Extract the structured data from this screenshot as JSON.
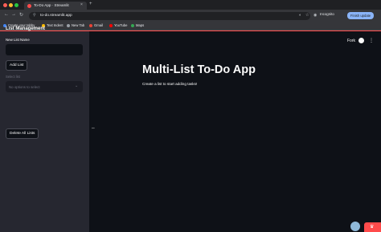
{
  "browser": {
    "tab_title": "To-Do App · Streamlit",
    "tab_close": "×",
    "new_tab": "+",
    "back": "←",
    "forward": "→",
    "reload": "↻",
    "url": "to-do.streamlit.app",
    "incognito_label": "Incognito",
    "finish_update_label": "Finish update",
    "bookmarks": [
      {
        "label": "Create your tabby",
        "color": "#4285f4"
      },
      {
        "label": "Text Indent",
        "color": "#fbbc04"
      },
      {
        "label": "New Tab",
        "color": "#9aa0a6"
      },
      {
        "label": "Gmail",
        "color": "#ea4335"
      },
      {
        "label": "YouTube",
        "color": "#ff0000"
      },
      {
        "label": "Maps",
        "color": "#34a853"
      }
    ]
  },
  "sidebar": {
    "title": "List Management",
    "new_list_label": "New List Name",
    "new_list_value": "",
    "add_list_button": "Add List",
    "select_label": "Select list",
    "select_placeholder": "No options to select",
    "select_chevron": "⌄",
    "delete_all_button": "Delete All Lists"
  },
  "header": {
    "deploy_label": "Fork",
    "menu_glyph": "⋮"
  },
  "main": {
    "title": "Multi-List To-Do App",
    "caption": "Create a list to start adding tasks!"
  },
  "colors": {
    "accent": "#ff4b4b",
    "background": "#0e1117",
    "sidebar": "#262730"
  },
  "icons": {
    "github": "github-icon",
    "manage_app": "crown-icon"
  }
}
